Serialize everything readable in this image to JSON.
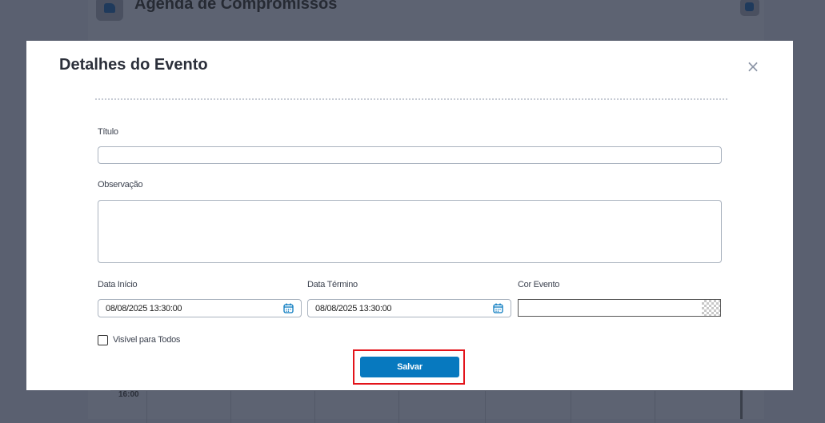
{
  "background": {
    "app_title": "Agenda de Compromissos",
    "calendar_time": "16:00",
    "logo_icon": "book-icon",
    "action_icon": "print-icon"
  },
  "modal": {
    "title": "Detalhes do Evento",
    "close_label": "×",
    "close_icon": "close-icon",
    "fields": {
      "titulo": {
        "label": "Título",
        "value": "",
        "placeholder": ""
      },
      "observacao": {
        "label": "Observação",
        "value": "",
        "placeholder": ""
      },
      "data_inicio": {
        "label": "Data Início",
        "value": "08/08/2025 13:30:00"
      },
      "data_termino": {
        "label": "Data Término",
        "value": "08/08/2025 13:30:00"
      },
      "cor_evento": {
        "label": "Cor Evento",
        "value": ""
      }
    },
    "checkbox": {
      "label": "Visível para Todos",
      "checked": false
    },
    "save_label": "Salvar",
    "colors": {
      "primary_button": "#0779bf",
      "highlight": "#e3141b",
      "title_text": "#2b2f3a"
    }
  }
}
